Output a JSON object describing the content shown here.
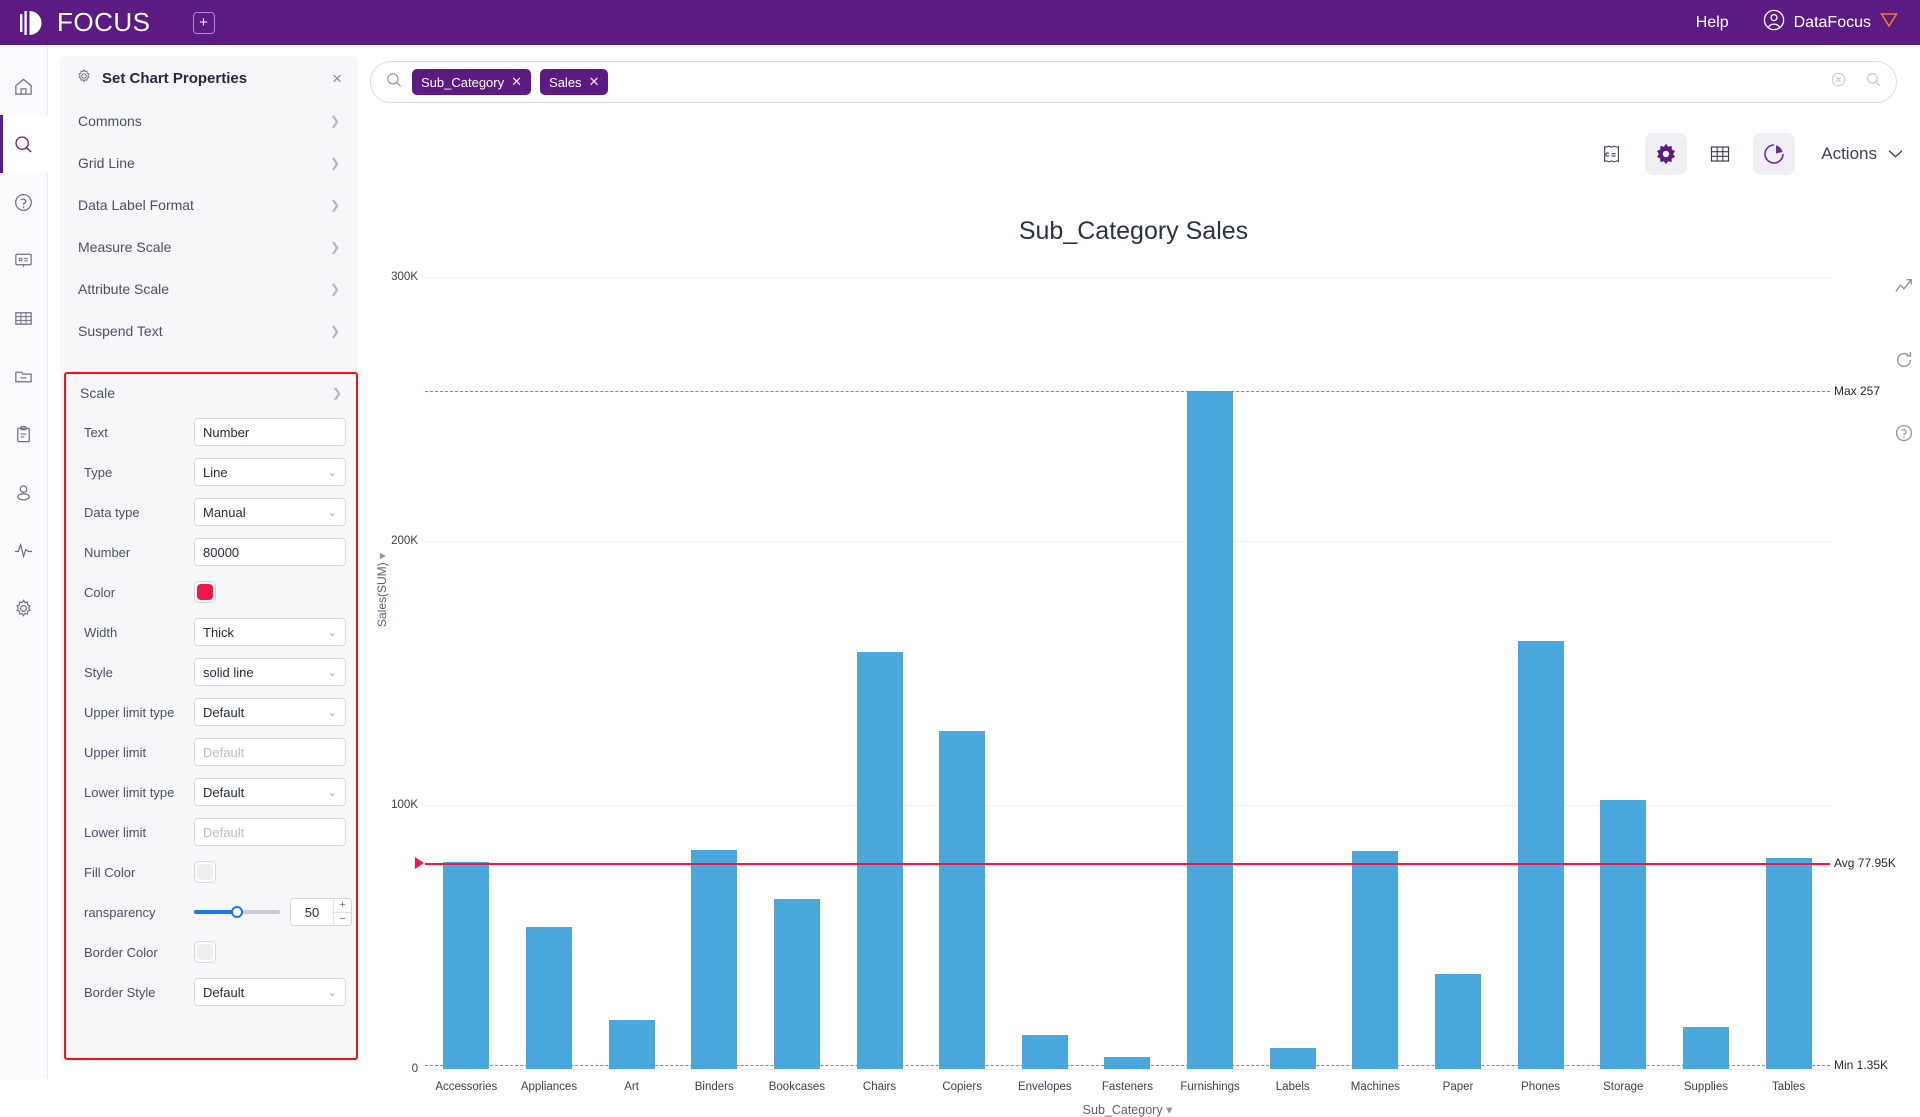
{
  "topbar": {
    "logo_text": "FOCUS",
    "add_tab_label": "+",
    "help_label": "Help",
    "user_name": "DataFocus"
  },
  "rail": {
    "items": [
      {
        "name": "home-icon",
        "active": false
      },
      {
        "name": "search-icon",
        "active": true
      },
      {
        "name": "help-circle-icon",
        "active": false
      },
      {
        "name": "presentation-icon",
        "active": false
      },
      {
        "name": "table-icon",
        "active": false
      },
      {
        "name": "folder-icon",
        "active": false
      },
      {
        "name": "clipboard-icon",
        "active": false
      },
      {
        "name": "user-icon",
        "active": false
      },
      {
        "name": "activity-icon",
        "active": false
      },
      {
        "name": "settings-icon",
        "active": false
      }
    ]
  },
  "panel": {
    "title": "Set Chart Properties",
    "close_label": "×",
    "sections": [
      {
        "label": "Commons"
      },
      {
        "label": "Grid Line"
      },
      {
        "label": "Data Label Format"
      },
      {
        "label": "Measure Scale"
      },
      {
        "label": "Attribute Scale"
      },
      {
        "label": "Suspend Text"
      }
    ],
    "scale": {
      "header": "Scale",
      "fields": [
        {
          "label": "Text",
          "value": "Number",
          "kind": "input",
          "placeholder": ""
        },
        {
          "label": "Type",
          "value": "Line",
          "kind": "select"
        },
        {
          "label": "Data type",
          "value": "Manual",
          "kind": "select"
        },
        {
          "label": "Number",
          "value": "80000",
          "kind": "input",
          "placeholder": ""
        },
        {
          "label": "Color",
          "value": "",
          "kind": "color",
          "color": "#f2174a"
        },
        {
          "label": "Width",
          "value": "Thick",
          "kind": "select"
        },
        {
          "label": "Style",
          "value": "solid line",
          "kind": "select"
        },
        {
          "label": "Upper limit type",
          "value": "Default",
          "kind": "select"
        },
        {
          "label": "Upper limit",
          "value": "",
          "kind": "input",
          "placeholder": "Default"
        },
        {
          "label": "Lower limit type",
          "value": "Default",
          "kind": "select"
        },
        {
          "label": "Lower limit",
          "value": "",
          "kind": "input",
          "placeholder": "Default"
        },
        {
          "label": "Fill Color",
          "value": "",
          "kind": "color",
          "color": "#efeff1"
        },
        {
          "label": "ransparency",
          "value": "50",
          "kind": "slider"
        },
        {
          "label": "Border Color",
          "value": "",
          "kind": "color",
          "color": "#efeff1"
        },
        {
          "label": "Border Style",
          "value": "Default",
          "kind": "select"
        }
      ]
    }
  },
  "search": {
    "chips": [
      {
        "label": "Sub_Category",
        "remove": "✕"
      },
      {
        "label": "Sales",
        "remove": "✕"
      }
    ]
  },
  "toolbar": {
    "buttons": [
      {
        "name": "formula-icon",
        "active": false
      },
      {
        "name": "gear-icon",
        "active": true
      },
      {
        "name": "table-grid-icon",
        "active": false
      },
      {
        "name": "pie-chart-icon",
        "active": true
      }
    ],
    "actions_label": "Actions"
  },
  "chart_data": {
    "type": "bar",
    "title": "Sub_Category Sales",
    "xlabel": "Sub_Category",
    "ylabel": "Sales(SUM)",
    "ylim": [
      0,
      300000
    ],
    "yticks": [
      {
        "label": "300K",
        "value": 300000
      },
      {
        "label": "200K",
        "value": 200000
      },
      {
        "label": "100K",
        "value": 100000
      },
      {
        "label": "0",
        "value": 0
      }
    ],
    "grid": true,
    "legend": "none",
    "bar_color": "#4aa8dc",
    "categories": [
      "Accessories",
      "Appliances",
      "Art",
      "Binders",
      "Bookcases",
      "Chairs",
      "Copiers",
      "Envelopes",
      "Fasteners",
      "Furnishings",
      "Labels",
      "Machines",
      "Paper",
      "Phones",
      "Storage",
      "Supplies",
      "Tables"
    ],
    "values": [
      78500,
      53900,
      18500,
      83000,
      64500,
      158000,
      128000,
      12800,
      4500,
      257000,
      8100,
      82500,
      36000,
      162000,
      102000,
      16000,
      80000
    ],
    "annotations": [
      {
        "name": "max-line",
        "label": "Max 257",
        "value": 257000,
        "color": "#35a7e0",
        "style": "dashed"
      },
      {
        "name": "avg-line",
        "label": "Avg 77.95K",
        "value": 77950,
        "color": "#f2174a",
        "style": "solid"
      },
      {
        "name": "min-line",
        "label": "Min 1.35K",
        "value": 1350,
        "color": "#35a7e0",
        "style": "dashed"
      }
    ]
  },
  "right_icons": [
    {
      "name": "trend-line-icon"
    },
    {
      "name": "refresh-icon"
    },
    {
      "name": "help-circle-icon"
    }
  ]
}
